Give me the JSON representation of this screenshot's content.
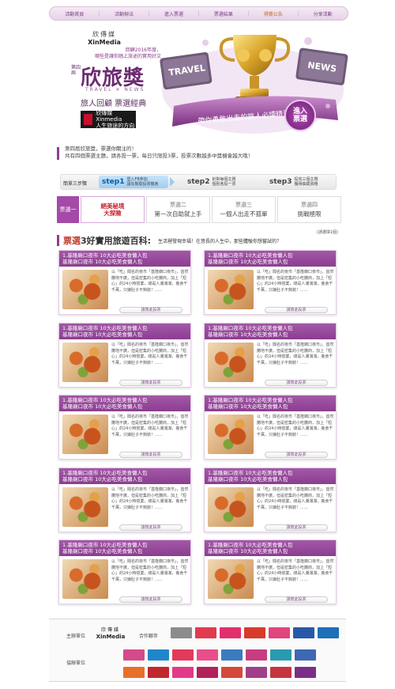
{
  "nav": [
    "活動首頁",
    "活動辦法",
    "進入票選",
    "票選結果",
    "得獎公告",
    "分享活動"
  ],
  "hero": {
    "brand_cn": "欣傳媒",
    "brand_en": "XinMedia",
    "subtitle": "回顧2016年度，\n哪些是讓你踏上旅途的實用好文",
    "edition": "第四屆",
    "title": "欣旅獎",
    "travel_news": "TRAVEL ✕ NEWS",
    "tagline": "旅人回顧  票選經典",
    "logo_text": "欣傳媒Xinmedia\n人生旅途的方向",
    "art_travel": "TRAVEL",
    "art_news": "NEWS",
    "art_banner": "帶你勇敢出走的旅人必讀精選",
    "enter_badge": "進入\n票選"
  },
  "notice": {
    "line1": "第四屆欣旅獎，票選你關注的！",
    "line2": "共有四個票選主題，請各投一票，每日只限投3票，投票次數越多中獎機會越大哦！"
  },
  "steps": {
    "label": "簡單三步驟",
    "items": [
      {
        "num": "step1",
        "desc": "登入FB參加\n讓先幫取投票機會"
      },
      {
        "num": "step2",
        "desc": "針對每個主題\n個別各投一票"
      },
      {
        "num": "step3",
        "desc": "投完三個主題\n獲得抽獎資格"
      }
    ]
  },
  "tabs": {
    "head": "票選一",
    "items": [
      {
        "t1": "",
        "t2": "絕美秘境\n大探險"
      },
      {
        "t1": "票選二",
        "t2": "第一次自助就上手"
      },
      {
        "t1": "票選三",
        "t2": "一個人出走不孤單"
      },
      {
        "t1": "票選四",
        "t2": "挑戰極限"
      }
    ]
  },
  "section": {
    "note": "(請選擇1個)",
    "title_hl": "票選",
    "title": "3好實用旅遊百科:",
    "sub": "生活裡發現幸福！在悠長的人生中，那些體驗你想嘗試的？"
  },
  "cards": [
    {
      "title": "1.基隆廟口夜市 10大必吃美食懶人包\n基隆廟口夜市 10大必吃美食懶人包",
      "desc": "以「吃」聞名的夜市「基隆廟口夜市」，首然攤地不廣，但是密集的小吃攤商，加上「短心」的24小時營業，總是人潮滿滿，養食千千萬，只嫌肚子不夠裝！......",
      "vote": "請按此投票"
    },
    {
      "title": "1.基隆廟口夜市 10大必吃美食懶人包\n基隆廟口夜市 10大必吃美食懶人包",
      "desc": "以「吃」聞名的夜市「基隆廟口夜市」，首然攤地不廣，但是密集的小吃攤商，加上「短心」的24小時營業，總是人潮滿滿，養食千千萬，只嫌肚子不夠裝！......",
      "vote": "請按此投票"
    },
    {
      "title": "1.基隆廟口夜市 10大必吃美食懶人包\n基隆廟口夜市 10大必吃美食懶人包",
      "desc": "以「吃」聞名的夜市「基隆廟口夜市」，首然攤地不廣，但是密集的小吃攤商，加上「短心」的24小時營業，總是人潮滿滿，養食千千萬，只嫌肚子不夠裝！......",
      "vote": "請按此投票"
    },
    {
      "title": "1.基隆廟口夜市 10大必吃美食懶人包\n基隆廟口夜市 10大必吃美食懶人包",
      "desc": "以「吃」聞名的夜市「基隆廟口夜市」，首然攤地不廣，但是密集的小吃攤商，加上「短心」的24小時營業，總是人潮滿滿，養食千千萬，只嫌肚子不夠裝！......",
      "vote": "請按此投票"
    },
    {
      "title": "1.基隆廟口夜市 10大必吃美食懶人包\n基隆廟口夜市 10大必吃美食懶人包",
      "desc": "以「吃」聞名的夜市「基隆廟口夜市」，首然攤地不廣，但是密集的小吃攤商，加上「短心」的24小時營業，總是人潮滿滿，養食千千萬，只嫌肚子不夠裝！......",
      "vote": "請按此投票"
    },
    {
      "title": "1.基隆廟口夜市 10大必吃美食懶人包\n基隆廟口夜市 10大必吃美食懶人包",
      "desc": "以「吃」聞名的夜市「基隆廟口夜市」，首然攤地不廣，但是密集的小吃攤商，加上「短心」的24小時營業，總是人潮滿滿，養食千千萬，只嫌肚子不夠裝！......",
      "vote": "請按此投票"
    },
    {
      "title": "1.基隆廟口夜市 10大必吃美食懶人包\n基隆廟口夜市 10大必吃美食懶人包",
      "desc": "以「吃」聞名的夜市「基隆廟口夜市」，首然攤地不廣，但是密集的小吃攤商，加上「短心」的24小時營業，總是人潮滿滿，養食千千萬，只嫌肚子不夠裝！......",
      "vote": "請按此投票"
    },
    {
      "title": "1.基隆廟口夜市 10大必吃美食懶人包\n基隆廟口夜市 10大必吃美食懶人包",
      "desc": "以「吃」聞名的夜市「基隆廟口夜市」，首然攤地不廣，但是密集的小吃攤商，加上「短心」的24小時營業，總是人潮滿滿，養食千千萬，只嫌肚子不夠裝！......",
      "vote": "請按此投票"
    },
    {
      "title": "1.基隆廟口夜市 10大必吃美食懶人包\n基隆廟口夜市 10大必吃美食懶人包",
      "desc": "以「吃」聞名的夜市「基隆廟口夜市」，首然攤地不廣，但是密集的小吃攤商，加上「短心」的24小時營業，總是人潮滿滿，養食千千萬，只嫌肚子不夠裝！......",
      "vote": "請按此投票"
    },
    {
      "title": "1.基隆廟口夜市 10大必吃美食懶人包\n基隆廟口夜市 10大必吃美食懶人包",
      "desc": "以「吃」聞名的夜市「基隆廟口夜市」，首然攤地不廣，但是密集的小吃攤商，加上「短心」的24小時營業，總是人潮滿滿，養食千千萬，只嫌肚子不夠裝！......",
      "vote": "請按此投票"
    }
  ],
  "footer": {
    "organizer_label": "主辦單位",
    "organizer_brand_cn": "欣傳媒",
    "organizer_brand_en": "XinMedia",
    "partner_label": "合作夥伴",
    "coorganizer_label": "協辦單位",
    "partner_colors": [
      "#8c8c8c",
      "#e23b4e",
      "#e2306c",
      "#d83a2b",
      "#e0457b",
      "#2a58a8",
      "#1d6fb8"
    ],
    "coorg_row1_colors": [
      "#d44a8a",
      "#1f86c9",
      "#e23a5b",
      "#e84e8a",
      "#3b7bbf",
      "#c63d80",
      "#2a9ab0",
      "#3f67b3"
    ],
    "coorg_row2_colors": [
      "#e7702a",
      "#c0282e",
      "#e23a8a",
      "#b2215a",
      "#d6483a",
      "#a23f8a",
      "#c5363e",
      "#7a2f86"
    ]
  }
}
